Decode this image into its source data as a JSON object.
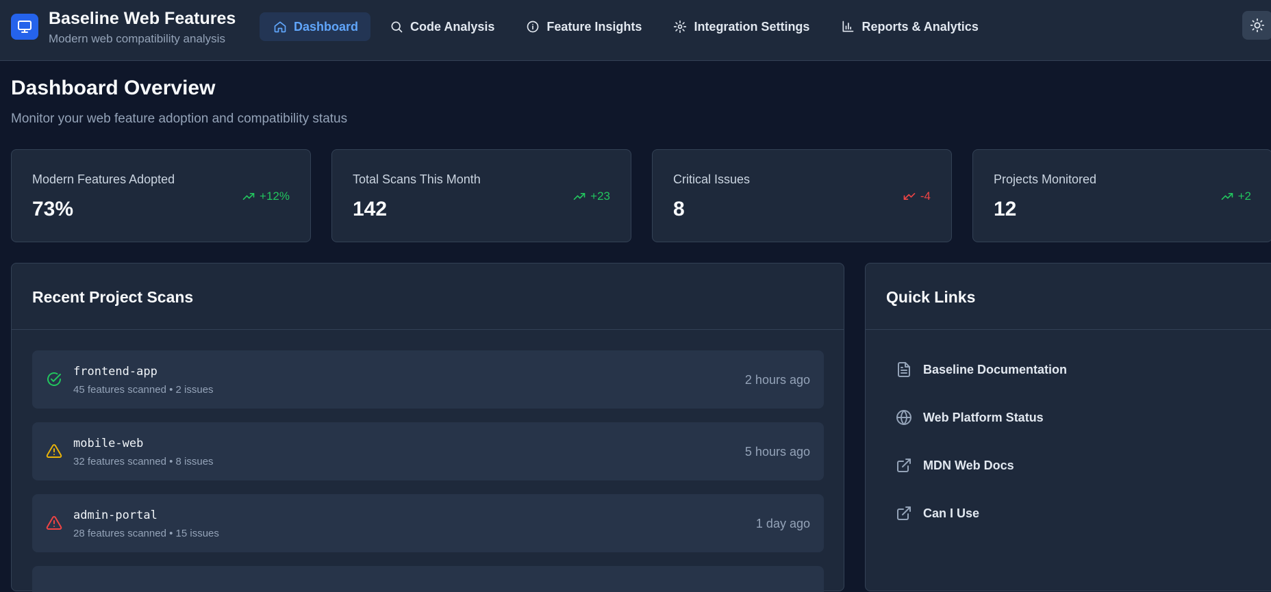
{
  "brand": {
    "title": "Baseline Web Features",
    "subtitle": "Modern web compatibility analysis",
    "icon": "monitor-icon"
  },
  "nav": {
    "items": [
      {
        "label": "Dashboard",
        "icon": "home-icon",
        "active": true
      },
      {
        "label": "Code Analysis",
        "icon": "search-icon",
        "active": false
      },
      {
        "label": "Feature Insights",
        "icon": "info-icon",
        "active": false
      },
      {
        "label": "Integration Settings",
        "icon": "gear-icon",
        "active": false
      },
      {
        "label": "Reports & Analytics",
        "icon": "bar-chart-icon",
        "active": false
      }
    ],
    "theme_toggle_icon": "sun-icon"
  },
  "page": {
    "title": "Dashboard Overview",
    "subtitle": "Monitor your web feature adoption and compatibility status"
  },
  "stats": [
    {
      "label": "Modern Features Adopted",
      "value": "73%",
      "trend": "+12%",
      "direction": "up"
    },
    {
      "label": "Total Scans This Month",
      "value": "142",
      "trend": "+23",
      "direction": "up"
    },
    {
      "label": "Critical Issues",
      "value": "8",
      "trend": "-4",
      "direction": "down"
    },
    {
      "label": "Projects Monitored",
      "value": "12",
      "trend": "+2",
      "direction": "up"
    }
  ],
  "recent_scans": {
    "title": "Recent Project Scans",
    "items": [
      {
        "name": "frontend-app",
        "meta": "45 features scanned • 2 issues",
        "time": "2 hours ago",
        "status": "success",
        "icon": "check-circle-icon"
      },
      {
        "name": "mobile-web",
        "meta": "32 features scanned • 8 issues",
        "time": "5 hours ago",
        "status": "warning",
        "icon": "warning-triangle-icon"
      },
      {
        "name": "admin-portal",
        "meta": "28 features scanned • 15 issues",
        "time": "1 day ago",
        "status": "critical",
        "icon": "alert-triangle-icon"
      }
    ]
  },
  "quick_links": {
    "title": "Quick Links",
    "items": [
      {
        "label": "Baseline Documentation",
        "icon": "document-icon"
      },
      {
        "label": "Web Platform Status",
        "icon": "globe-icon"
      },
      {
        "label": "MDN Web Docs",
        "icon": "external-link-icon"
      },
      {
        "label": "Can I Use",
        "icon": "external-link-icon"
      }
    ]
  },
  "colors": {
    "accent": "#2563eb",
    "active_nav": "#60a5fa",
    "trend_up": "#22c55e",
    "trend_down": "#ef4444",
    "warning": "#eab308"
  }
}
